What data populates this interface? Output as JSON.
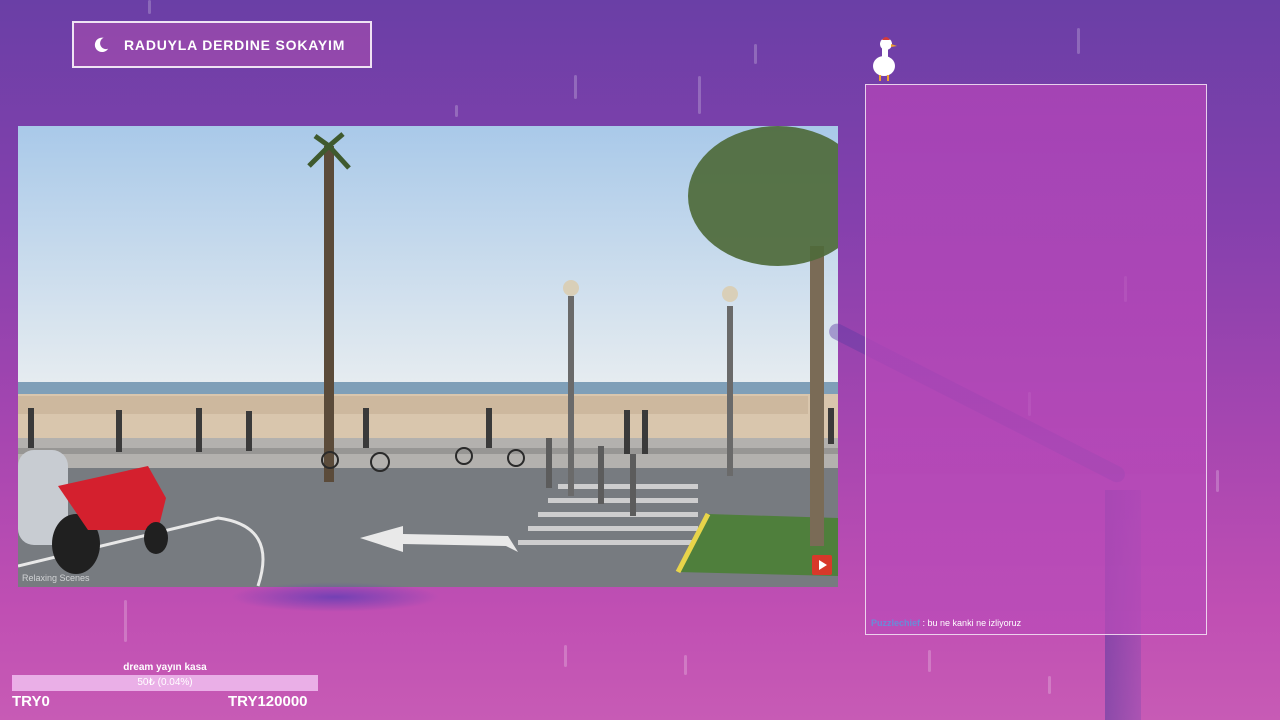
{
  "header": {
    "title": "RADUYLA DERDINE SOKAYIM",
    "icon": "crescent-moon-icon"
  },
  "video": {
    "watermark": "Relaxing Scenes",
    "badge_icon": "youtube-play-icon"
  },
  "chat": {
    "mascot_icon": "goose-icon",
    "messages": [
      {
        "user": "Puzzlechief",
        "separator": " : ",
        "text": "bu ne kanki ne izliyoruz"
      }
    ]
  },
  "goal": {
    "label": "dream yayın kasa",
    "progress_text": "50₺ (0.04%)",
    "progress_fraction": 0.0004,
    "min_label": "TRY0",
    "max_label": "TRY120000"
  },
  "colors": {
    "accent": "#a646b0",
    "goal_track": "#f0bef0",
    "chat_user": "#6a8bd8"
  }
}
